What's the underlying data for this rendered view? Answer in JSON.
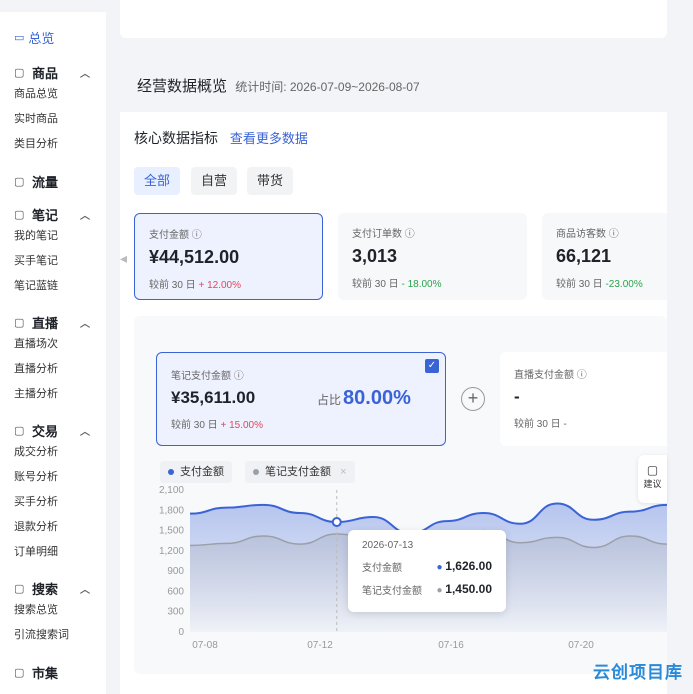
{
  "sidebar": {
    "top": {
      "label": "总览",
      "icon": "monitor-icon"
    },
    "groups": [
      {
        "title": "商品",
        "icon": "bag-icon",
        "items": [
          "商品总览",
          "实时商品",
          "类目分析"
        ],
        "expanded": true
      },
      {
        "title": "流量",
        "icon": "flow-icon",
        "items": []
      },
      {
        "title": "笔记",
        "icon": "note-icon",
        "items": [
          "我的笔记",
          "买手笔记",
          "笔记蓝链"
        ],
        "expanded": true
      },
      {
        "title": "直播",
        "icon": "play-icon",
        "items": [
          "直播场次",
          "直播分析",
          "主播分析"
        ],
        "expanded": true
      },
      {
        "title": "交易",
        "icon": "trade-icon",
        "items": [
          "成交分析",
          "账号分析",
          "买手分析",
          "退款分析",
          "订单明细"
        ],
        "expanded": true
      },
      {
        "title": "搜索",
        "icon": "search-icon",
        "items": [
          "搜索总览",
          "引流搜索词"
        ],
        "expanded": true
      },
      {
        "title": "市集",
        "icon": "market-icon",
        "items": []
      }
    ]
  },
  "header": {
    "title": "经营数据概览",
    "period_label": "统计时间:",
    "period": "2026-07-09~2026-08-07"
  },
  "kpi": {
    "title": "核心数据指标",
    "more_link": "查看更多数据"
  },
  "tabs": [
    "全部",
    "自营",
    "带货"
  ],
  "cards": [
    {
      "label": "支付金额",
      "value": "¥44,512.00",
      "cmp_label": "较前 30 日",
      "change": "+ 12.00%",
      "dir": "up"
    },
    {
      "label": "支付订单数",
      "value": "3,013",
      "cmp_label": "较前 30 日",
      "change": "- 18.00%",
      "dir": "down"
    },
    {
      "label": "商品访客数",
      "value": "66,121",
      "cmp_label": "较前 30 日",
      "change": "-23.00%",
      "dir": "down"
    }
  ],
  "sub_cards": [
    {
      "label": "笔记支付金额",
      "value": "¥35,611.00",
      "ratio_label": "占比",
      "ratio": "80.00%",
      "cmp_label": "较前 30 日",
      "change": "+ 15.00%"
    },
    {
      "label": "直播支付金额",
      "value": "-",
      "cmp_label": "较前 30 日",
      "change": "-"
    }
  ],
  "legend": [
    {
      "name": "支付金额",
      "color": "#3a63d6"
    },
    {
      "name": "笔记支付金额",
      "color": "#9aa0a8"
    }
  ],
  "suggest_label": "建议",
  "chart_data": {
    "type": "area",
    "y_ticks": [
      "2,100",
      "1,800",
      "1,500",
      "1,200",
      "900",
      "600",
      "300",
      "0"
    ],
    "ylim": [
      0,
      2100
    ],
    "x_ticks": [
      "07-08",
      "07-12",
      "07-16",
      "07-20"
    ],
    "x": [
      "07-09",
      "07-10",
      "07-11",
      "07-12",
      "07-13",
      "07-14",
      "07-15",
      "07-16",
      "07-17",
      "07-18",
      "07-19",
      "07-20",
      "07-21",
      "07-22"
    ],
    "series": [
      {
        "name": "支付金额",
        "values": [
          1750,
          1840,
          1880,
          1760,
          1626,
          1700,
          1460,
          1640,
          1760,
          1600,
          1900,
          1660,
          1780,
          1880
        ]
      },
      {
        "name": "笔记支付金额",
        "values": [
          1280,
          1310,
          1420,
          1300,
          1450,
          1390,
          1260,
          1400,
          1500,
          1320,
          1400,
          1250,
          1420,
          1300
        ]
      }
    ],
    "colors": [
      "#3a63d6",
      "#9aa0a8"
    ]
  },
  "tooltip": {
    "date": "2026-07-13",
    "rows": [
      {
        "label": "支付金额",
        "value": "1,626.00"
      },
      {
        "label": "笔记支付金额",
        "value": "1,450.00"
      }
    ]
  },
  "watermark": "云创项目库"
}
